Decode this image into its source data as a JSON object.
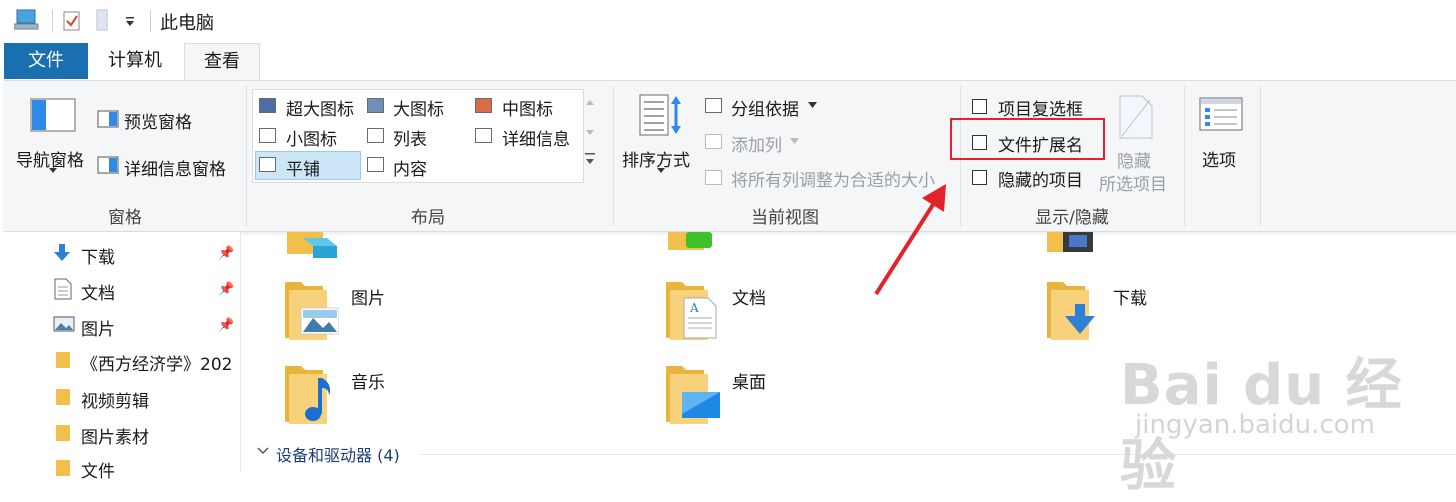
{
  "window": {
    "title": "此电脑"
  },
  "tabs": [
    {
      "label": "文件",
      "active": false
    },
    {
      "label": "计算机",
      "active": false
    },
    {
      "label": "查看",
      "active": true
    }
  ],
  "ribbon": {
    "panes": {
      "group_label": "窗格",
      "nav_pane": "导航窗格",
      "preview_pane": "预览窗格",
      "details_pane": "详细信息窗格"
    },
    "layout": {
      "group_label": "布局",
      "items": [
        "超大图标",
        "大图标",
        "中图标",
        "小图标",
        "列表",
        "详细信息",
        "平铺",
        "内容"
      ],
      "selected": "平铺"
    },
    "current_view": {
      "group_label": "当前视图",
      "sort_by": "排序方式",
      "group_by": "分组依据",
      "add_columns": "添加列",
      "size_all_columns": "将所有列调整为合适的大小"
    },
    "show_hide": {
      "group_label": "显示/隐藏",
      "item_checkboxes": "项目复选框",
      "file_extensions": "文件扩展名",
      "hidden_items": "隐藏的项目",
      "hide_selected_line1": "隐藏",
      "hide_selected_line2": "所选项目"
    },
    "options": "选项"
  },
  "nav": [
    {
      "label": "下载",
      "icon": "download-arrow-icon",
      "pinned": true
    },
    {
      "label": "文档",
      "icon": "document-icon",
      "pinned": true
    },
    {
      "label": "图片",
      "icon": "picture-icon",
      "pinned": true
    },
    {
      "label": "《西方经济学》202",
      "icon": "folder-icon",
      "pinned": false
    },
    {
      "label": "视频剪辑",
      "icon": "folder-icon",
      "pinned": false
    },
    {
      "label": "图片素材",
      "icon": "folder-icon",
      "pinned": false
    },
    {
      "label": "文件",
      "icon": "folder-icon",
      "pinned": false
    }
  ],
  "folders": [
    {
      "label": "图片",
      "icon": "pictures-folder-icon"
    },
    {
      "label": "文档",
      "icon": "documents-folder-icon"
    },
    {
      "label": "下载",
      "icon": "downloads-folder-icon"
    },
    {
      "label": "音乐",
      "icon": "music-folder-icon"
    },
    {
      "label": "桌面",
      "icon": "desktop-folder-icon"
    }
  ],
  "devices_header": "设备和驱动器 (4)",
  "watermark": {
    "main": "Bai du 经验",
    "sub": "jingyan.baidu.com"
  },
  "colors": {
    "file_tab": "#1a6fb0",
    "highlight": "#e3222b",
    "selected_tile": "#cde6f7",
    "folder": "#f2c04a"
  }
}
